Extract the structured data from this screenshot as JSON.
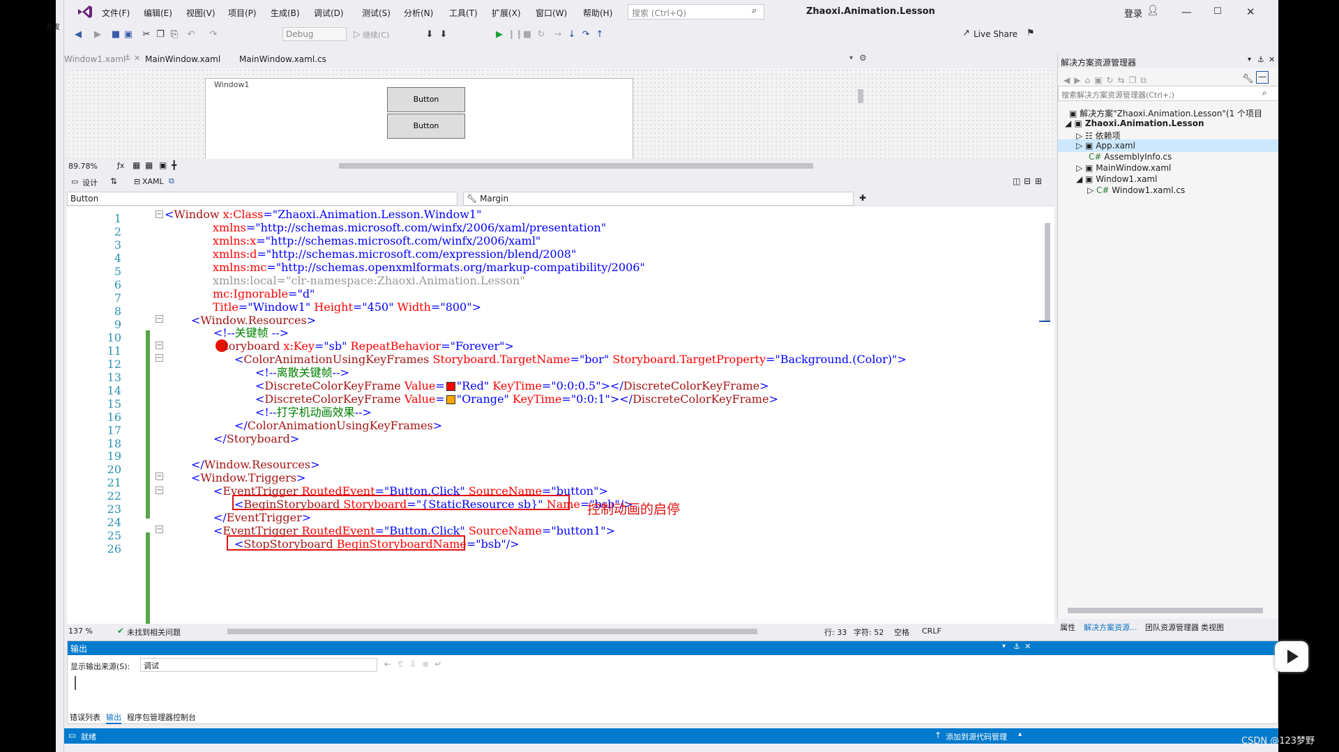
{
  "menus": [
    "文件(F)",
    "编辑(E)",
    "视图(V)",
    "项目(P)",
    "生成(B)",
    "调试(D)",
    "测试(S)",
    "分析(N)",
    "工具(T)",
    "扩展(X)",
    "窗口(W)",
    "帮助(H)"
  ],
  "search_placeholder": "搜索 (Ctrl+Q)",
  "project_title": "Zhaoxi.Animation.Lesson",
  "login": "登录",
  "live_share": "Live Share",
  "debug_config": "Debug",
  "continue_label": "继续(C)",
  "left_strip_text": "开发",
  "tabs": [
    "Window1.xaml",
    "MainWindow.xaml",
    "MainWindow.xaml.cs"
  ],
  "designer": {
    "window_title": "Window1",
    "button1": "Button",
    "button2": "Button",
    "zoom": "89.78%",
    "design_label": "设计",
    "xaml_label": "XAML"
  },
  "combo_left": "Button",
  "combo_right": "Margin",
  "code_lines": [
    {
      "n": "1"
    },
    {
      "n": "2"
    },
    {
      "n": "3"
    },
    {
      "n": "4"
    },
    {
      "n": "5"
    },
    {
      "n": "6"
    },
    {
      "n": "7"
    },
    {
      "n": "8"
    },
    {
      "n": "9"
    },
    {
      "n": "10"
    },
    {
      "n": "11"
    },
    {
      "n": "12"
    },
    {
      "n": "13"
    },
    {
      "n": "14"
    },
    {
      "n": "15"
    },
    {
      "n": "16"
    },
    {
      "n": "17"
    },
    {
      "n": "18"
    },
    {
      "n": "19"
    },
    {
      "n": "20"
    },
    {
      "n": "21"
    },
    {
      "n": "22"
    },
    {
      "n": "23"
    },
    {
      "n": "24"
    },
    {
      "n": "25"
    },
    {
      "n": "26"
    }
  ],
  "annotation": "控制动画的启停",
  "editor_status": {
    "zoom": "137 %",
    "issues": "未找到相关问题",
    "row": "行: 33",
    "col": "字符: 52",
    "space": "空格",
    "crlf": "CRLF"
  },
  "solution_explorer": {
    "title": "解决方案资源管理器",
    "search": "搜索解决方案资源管理器(Ctrl+;)",
    "solution": "解决方案\"Zhaoxi.Animation.Lesson\"(1 个项目",
    "project": "Zhaoxi.Animation.Lesson",
    "items": [
      "依赖项",
      "App.xaml",
      "AssemblyInfo.cs",
      "MainWindow.xaml",
      "Window1.xaml",
      "Window1.xaml.cs"
    ],
    "bottom_tabs": [
      "属性",
      "解决方案资源...",
      "团队资源管理器",
      "类视图"
    ]
  },
  "output": {
    "title": "输出",
    "source_label": "显示输出来源(S):",
    "source_value": "调试",
    "tabs": [
      "错误列表",
      "输出",
      "程序包管理器控制台"
    ]
  },
  "status": {
    "ready": "就绪",
    "source_control": "添加到源代码管理",
    "watermark": "CSDN @123梦野"
  }
}
